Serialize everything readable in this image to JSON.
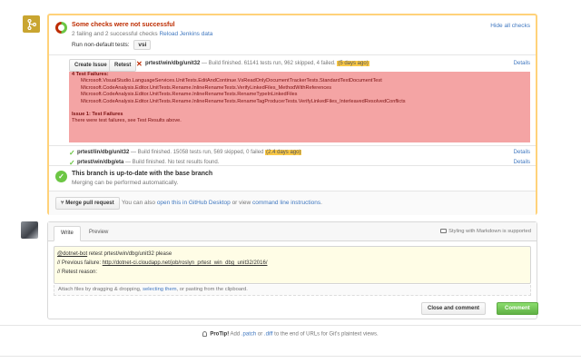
{
  "merge_status": {
    "title": "Some checks were not successful",
    "summary": "2 failing and 2 successful checks",
    "reload_link": "Reload Jenkins data",
    "run_tests_label": "Run non-default tests:",
    "vsi_label": "vsi",
    "hide_link": "Hide all checks"
  },
  "checks": [
    {
      "create_issue": "Create Issue",
      "retest": "Retest",
      "name": "prtest/win/dbg/unit32",
      "desc": "— Build finished. 61141 tests run, 962 skipped, 4 failed.",
      "age": "(5 days ago)",
      "details": "Details",
      "failures_title": "4 Test Failures:",
      "failures": [
        "Microsoft.VisualStudio.LanguageServices.UnitTests.EditAndContinue.VsReadOnlyDocumentTrackerTests.StandardTextDocumentTest",
        "Microsoft.CodeAnalysis.Editor.UnitTests.Rename.InlineRenameTests.VerifyLinkedFiles_MethodWithReferences",
        "Microsoft.CodeAnalysis.Editor.UnitTests.Rename.InlineRenameTests.RenameTypeInLinkedFiles",
        "Microsoft.CodeAnalysis.Editor.UnitTests.Rename.InlineRenameTests.RenameTagProducerTests.VerifyLinkedFiles_InterleavedResolvedConflicts"
      ],
      "issue_title": "Issue 1: Test Failures",
      "issue_desc": "There were test failures, see Test Results above."
    },
    {
      "name": "prtest/lin/dbg/unit32",
      "desc": "— Build finished. 15058 tests run, 569 skipped, 0 failed",
      "age": "(2.4 days ago)",
      "details": "Details"
    },
    {
      "name": "prtest/win/dbg/eta",
      "desc": "— Build finished. No test results found.",
      "details": "Details"
    }
  ],
  "uptodate": {
    "title": "This branch is up-to-date with the base branch",
    "sub": "Merging can be performed automatically."
  },
  "merge": {
    "button": "Merge pull request",
    "note_prefix": "You can also",
    "desktop_link": "open this in GitHub Desktop",
    "note_mid": "or view",
    "cli_link": "command line instructions",
    "note_end": "."
  },
  "comment": {
    "tab_write": "Write",
    "tab_preview": "Preview",
    "markdown_note": "Styling with Markdown is supported",
    "line1_mention": "@dotnet-bot",
    "line1_rest": " retest prtest/win/dbg/unit32 please",
    "line2_prefix": "// Previous failure: ",
    "line2_link": "http://dotnet-ci.cloudapp.net/job/roslyn_prtest_win_dbg_unit32/2016/",
    "line3": "// Retest reason:",
    "attach_prefix": "Attach files by dragging & dropping, ",
    "attach_link": "selecting them",
    "attach_suffix": ", or pasting from the clipboard.",
    "close_button": "Close and comment",
    "comment_button": "Comment"
  },
  "protip": {
    "label": "ProTip!",
    "text1": " Add ",
    "patch": ".patch",
    "text2": " or ",
    "diff": ".diff",
    "text3": " to the end of URLs for Git's plaintext views."
  },
  "colors": {
    "warning_border": "#ffd27a",
    "failure_bg": "#f4a4a4",
    "success": "#6cc644",
    "error": "#bd2c00",
    "link": "#4078c0"
  }
}
